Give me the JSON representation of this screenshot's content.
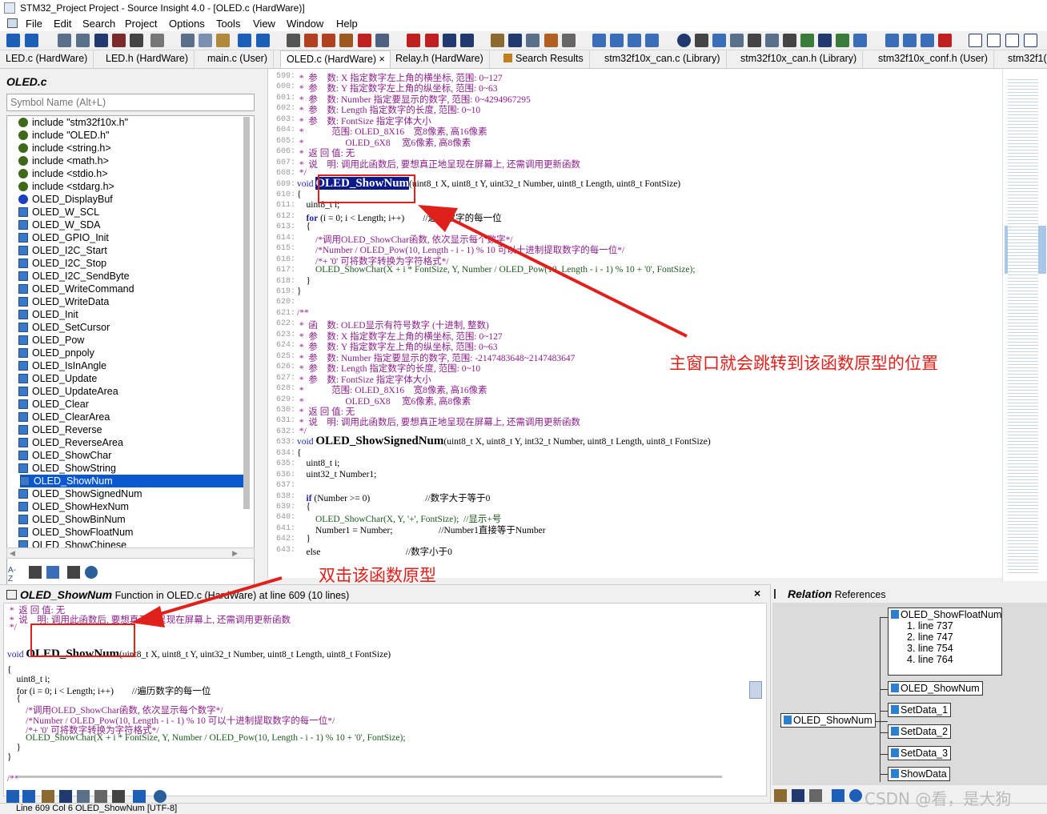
{
  "window": {
    "title": "STM32_Project Project - Source Insight 4.0 - [OLED.c (HardWare)]"
  },
  "menu": [
    "File",
    "Edit",
    "Search",
    "Project",
    "Options",
    "Tools",
    "View",
    "Window",
    "Help"
  ],
  "tabs": [
    "LED.c (HardWare)",
    "LED.h (HardWare)",
    "main.c (User)",
    "OLED.c (HardWare)",
    "×",
    "Relay.h (HardWare)",
    "Search Results",
    "stm32f10x_can.c (Library)",
    "stm32f10x_can.h (Library)",
    "stm32f10x_conf.h (User)",
    "stm32f1("
  ],
  "symbol_window": {
    "title": "OLED.c",
    "search_placeholder": "Symbol Name (Alt+L)",
    "items": [
      "include \"stm32f10x.h\"",
      "include \"OLED.h\"",
      "include <string.h>",
      "include <math.h>",
      "include <stdio.h>",
      "include <stdarg.h>",
      "OLED_DisplayBuf",
      "OLED_W_SCL",
      "OLED_W_SDA",
      "OLED_GPIO_Init",
      "OLED_I2C_Start",
      "OLED_I2C_Stop",
      "OLED_I2C_SendByte",
      "OLED_WriteCommand",
      "OLED_WriteData",
      "OLED_Init",
      "OLED_SetCursor",
      "OLED_Pow",
      "OLED_pnpoly",
      "OLED_IsInAngle",
      "OLED_Update",
      "OLED_UpdateArea",
      "OLED_Clear",
      "OLED_ClearArea",
      "OLED_Reverse",
      "OLED_ReverseArea",
      "OLED_ShowChar",
      "OLED_ShowString",
      "OLED_ShowNum",
      "OLED_ShowSignedNum",
      "OLED_ShowHexNum",
      "OLED_ShowBinNum",
      "OLED_ShowFloatNum",
      "OLED_ShowChinese"
    ],
    "selected": "OLED_ShowNum"
  },
  "editor": {
    "line_numbers": [
      "599:",
      "600:",
      "601:",
      "602:",
      "603:",
      "604:",
      "605:",
      "606:",
      "607:",
      "608:",
      "609:",
      "610:",
      "611:",
      "612:",
      "613:",
      "614:",
      "615:",
      "616:",
      "617:",
      "618:",
      "619:",
      "620:",
      "621:",
      "622:",
      "623:",
      "624:",
      "625:",
      "626:",
      "627:",
      "628:",
      "629:",
      "630:",
      "631:",
      "632:",
      "633:",
      "634:",
      "635:",
      "636:",
      "637:",
      "638:",
      "639:",
      "640:",
      "641:",
      "642:",
      "643:"
    ],
    "l599": " *  参    数: X 指定数字左上角的横坐标, 范围: 0~127",
    "l600": " *  参    数: Y 指定数字左上角的纵坐标, 范围: 0~63",
    "l601": " *  参    数: Number 指定要显示的数字, 范围: 0~4294967295",
    "l602": " *  参    数: Length 指定数字的长度, 范围: 0~10",
    "l603": " *  参    数: FontSize 指定字体大小",
    "l604": " *            范围: OLED_8X16    宽8像素, 高16像素",
    "l605": " *                  OLED_6X8     宽6像素, 高8像素",
    "l606": " *  返 回 值: 无",
    "l607": " *  说    明: 调用此函数后, 要想真正地呈现在屏幕上, 还需调用更新函数",
    "l608": " */",
    "l609_kw": "void ",
    "l609_fn": "OLED_ShowNum",
    "l609_rest": "(uint8_t X, uint8_t Y, uint32_t Number, uint8_t Length, uint8_t FontSize)",
    "l610": "{",
    "l611": "    uint8_t i;",
    "l612a": "    for",
    "l612b": " (i = 0; i < Length; i++)        //遍历数字的每一位",
    "l613": "    {",
    "l614": "        /*调用OLED_ShowChar函数, 依次显示每个数字*/",
    "l615": "        /*Number / OLED_Pow(10, Length - i - 1) % 10 可以十进制提取数字的每一位*/",
    "l616": "        /*+ '0' 可将数字转换为字符格式*/",
    "l617": "        OLED_ShowChar(X + i * FontSize, Y, Number / OLED_Pow(10, Length - i - 1) % 10 + '0', FontSize);",
    "l618": "    }",
    "l619": "}",
    "l620": "",
    "l621": "/**",
    "l622": " *  函    数: OLED显示有符号数字 (十进制, 整数)",
    "l623": " *  参    数: X 指定数字左上角的横坐标, 范围: 0~127",
    "l624": " *  参    数: Y 指定数字左上角的纵坐标, 范围: 0~63",
    "l625": " *  参    数: Number 指定要显示的数字, 范围: -2147483648~2147483647",
    "l626": " *  参    数: Length 指定数字的长度, 范围: 0~10",
    "l627": " *  参    数: FontSize 指定字体大小",
    "l628": " *            范围: OLED_8X16    宽8像素, 高16像素",
    "l629": " *                  OLED_6X8     宽6像素, 高8像素",
    "l630": " *  返 回 值: 无",
    "l631": " *  说    明: 调用此函数后, 要想真正地呈现在屏幕上, 还需调用更新函数",
    "l632": " */",
    "l633_kw": "void ",
    "l633_fn": "OLED_ShowSignedNum",
    "l633_rest": "(uint8_t X, uint8_t Y, int32_t Number, uint8_t Length, uint8_t FontSize)",
    "l634": "{",
    "l635": "    uint8_t i;",
    "l636": "    uint32_t Number1;",
    "l637": "",
    "l638a": "    if",
    "l638b": " (Number >= 0)                        //数字大于等于0",
    "l639": "    {",
    "l640": "        OLED_ShowChar(X, Y, '+', FontSize);  //显示+号",
    "l641": "        Number1 = Number;                    //Number1直接等于Number",
    "l642": "    }",
    "l643": "    else                                     //数字小于0"
  },
  "context": {
    "title_name": "OLED_ShowNum",
    "title_rest": " Function in OLED.c (HardWare) at line 609 (10 lines)",
    "c1": " *  返 回 值: 无",
    "c2": " *  说    明: 调用此函数后, 要想真正地呈现在屏幕上, 还需调用更新函数",
    "c3": " */",
    "c4_kw": "void ",
    "c4_fn": "OLED_ShowNum",
    "c4_rest": "(uint8_t X, uint8_t Y, uint32_t Number, uint8_t Length, uint8_t FontSize)",
    "c5": "{",
    "c6": "    uint8_t i;",
    "c7": "    for (i = 0; i < Length; i++)        //遍历数字的每一位",
    "c8": "    {",
    "c9": "        /*调用OLED_ShowChar函数, 依次显示每个数字*/",
    "c10": "        /*Number / OLED_Pow(10, Length - i - 1) % 10 可以十进制提取数字的每一位*/",
    "c11": "        /*+ '0' 可将数字转换为字符格式*/",
    "c12": "        OLED_ShowChar(X + i * FontSize, Y, Number / OLED_Pow(10, Length - i - 1) % 10 + '0', FontSize);",
    "c13": "    }",
    "c14": "}",
    "c15": "/**"
  },
  "relation": {
    "title_name": "Relation",
    "title_rest": " References",
    "root": "OLED_ShowNum",
    "float_node": "OLED_ShowFloatNum",
    "float_lines": [
      "1. line 737",
      "2. line 747",
      "3. line 754",
      "4. line 764"
    ],
    "children": [
      "OLED_ShowNum",
      "SetData_1",
      "SetData_2",
      "SetData_3",
      "ShowData"
    ]
  },
  "annotations": {
    "main": "主窗口就会跳转到该函数原型的位置",
    "dbl": "双击该函数原型",
    "watermark": "CSDN @看，是大狗"
  },
  "status": "Line 609  Col 6  OLED_ShowNum  [UTF-8]"
}
